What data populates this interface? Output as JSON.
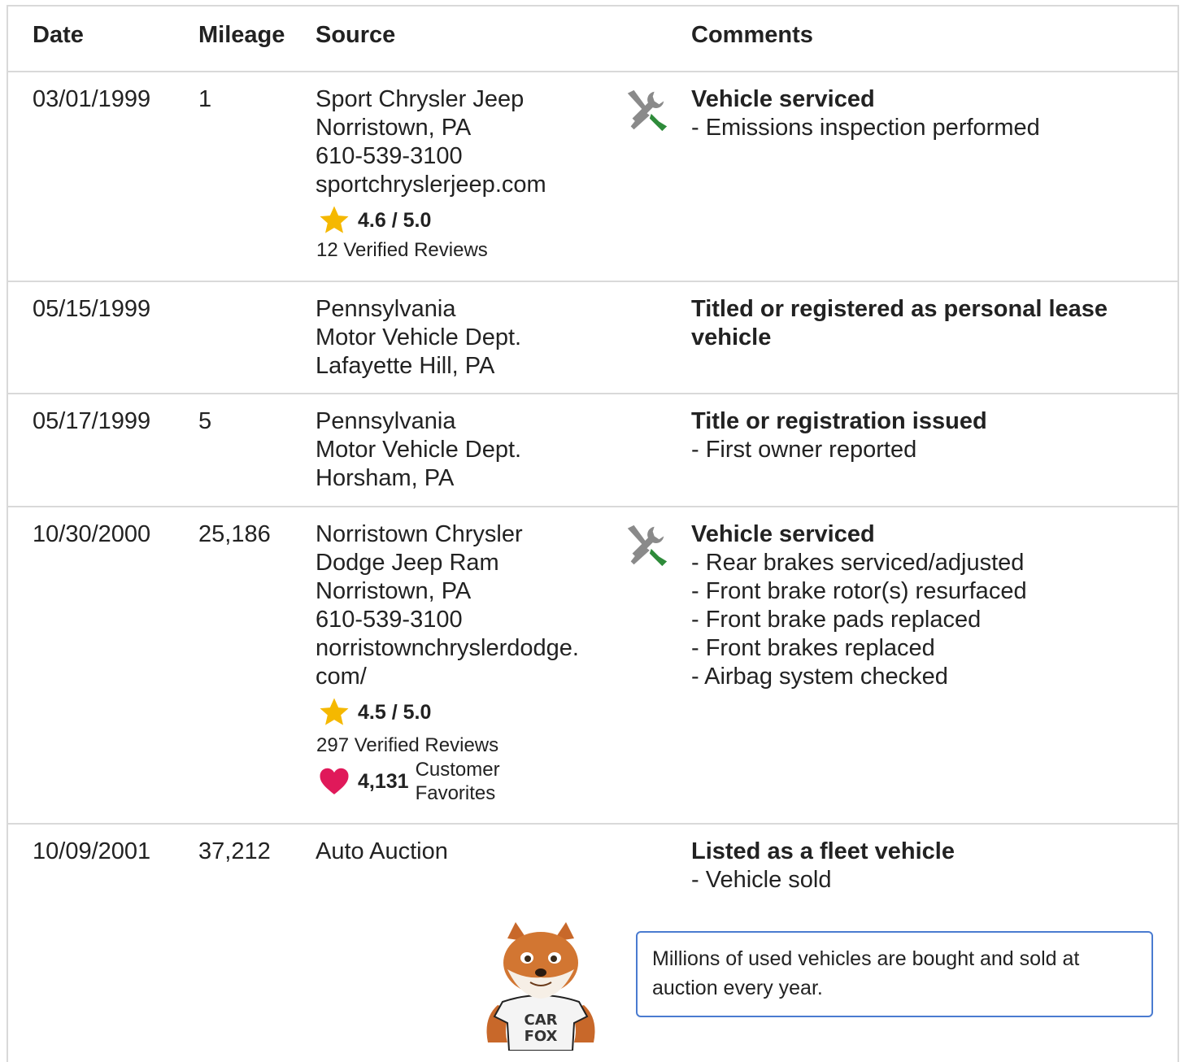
{
  "headers": {
    "date": "Date",
    "mileage": "Mileage",
    "source": "Source",
    "comments": "Comments"
  },
  "rows": [
    {
      "date": "03/01/1999",
      "mileage": "1",
      "source": [
        "Sport Chrysler Jeep",
        "Norristown, PA",
        "610-539-3100",
        "sportchryslerjeep.com"
      ],
      "rating": "4.6 / 5.0",
      "reviews": "12 Verified Reviews",
      "icon": "service-tools-icon",
      "comment_title": "Vehicle serviced",
      "comment_items": [
        "- Emissions inspection performed"
      ]
    },
    {
      "date": "05/15/1999",
      "mileage": "",
      "source": [
        "Pennsylvania",
        "Motor Vehicle Dept.",
        "Lafayette Hill, PA"
      ],
      "comment_title": [
        "Titled or registered as personal lease",
        "vehicle"
      ],
      "comment_items": []
    },
    {
      "date": "05/17/1999",
      "mileage": "5",
      "source": [
        "Pennsylvania",
        "Motor Vehicle Dept.",
        "Horsham, PA"
      ],
      "comment_title": "Title or registration issued",
      "comment_items": [
        "- First owner reported"
      ]
    },
    {
      "date": "10/30/2000",
      "mileage": "25,186",
      "source": [
        "Norristown Chrysler",
        "Dodge Jeep Ram",
        "Norristown, PA",
        "610-539-3100",
        "norristownchryslerdodge.",
        "com/"
      ],
      "rating": "4.5 / 5.0",
      "reviews": "297 Verified Reviews",
      "favorites_count": "4,131",
      "favorites_label": [
        "Customer",
        "Favorites"
      ],
      "icon": "service-tools-icon",
      "comment_title": "Vehicle serviced",
      "comment_items": [
        "- Rear brakes serviced/adjusted",
        "- Front brake rotor(s) resurfaced",
        "- Front brake pads replaced",
        "- Front brakes replaced",
        "- Airbag system checked"
      ]
    },
    {
      "date": "10/09/2001",
      "mileage": "37,212",
      "source": [
        "Auto Auction"
      ],
      "comment_title": "Listed as a fleet vehicle",
      "comment_items": [
        "- Vehicle sold"
      ]
    }
  ],
  "callout": "Millions of used vehicles are bought and sold at auction every year.",
  "fox_shirt": [
    "CAR",
    "FOX"
  ],
  "colors": {
    "star": "#f5b800",
    "heart": "#e0195a",
    "tool_gray": "#8a8a8a",
    "tool_green": "#2e8b3a",
    "callout_border": "#4a7bd0",
    "divider": "#d9d9d9"
  }
}
